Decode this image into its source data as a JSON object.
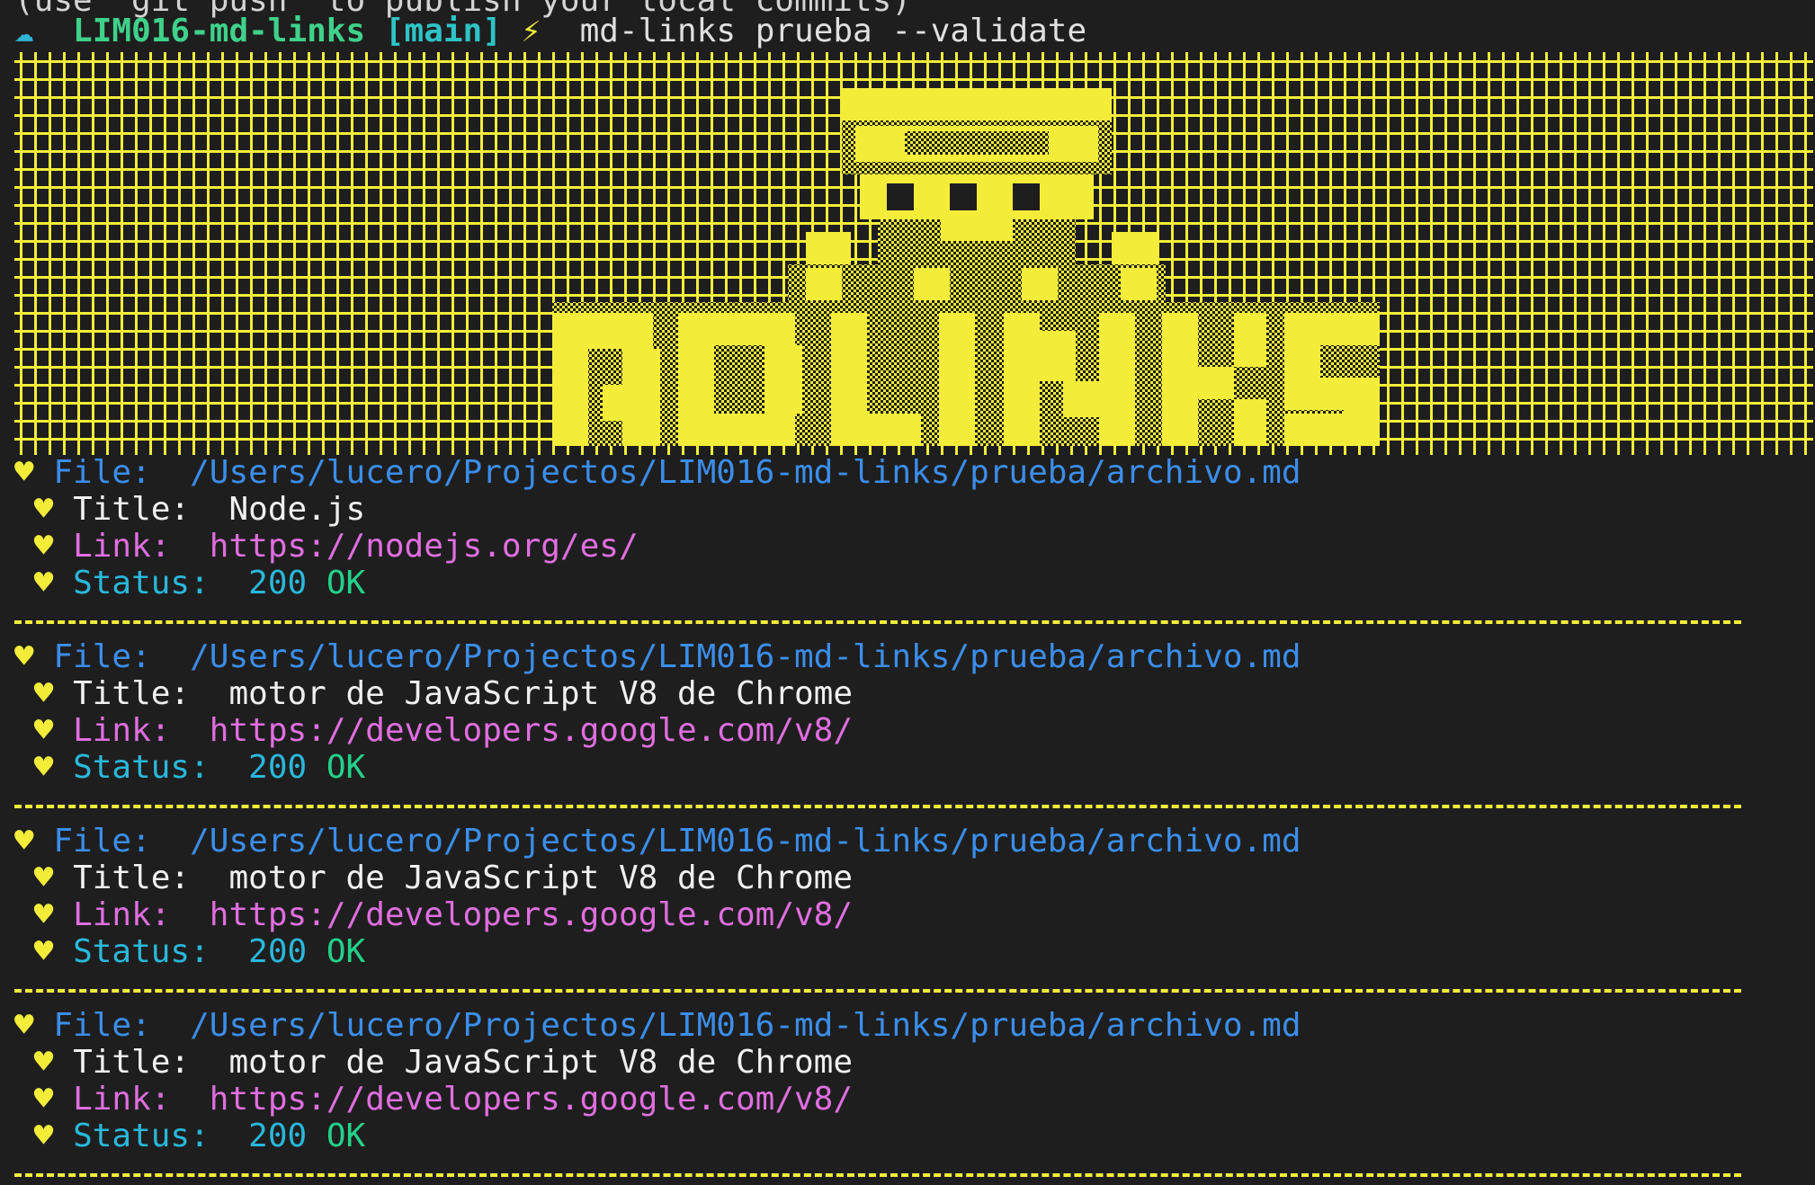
{
  "terminal": {
    "cut_line": "(use \"git push\" to publish your local commits)",
    "prompt": {
      "cloud_icon": "☁",
      "repo": "LIM016-md-links",
      "branch": "[main]",
      "bolt_icon": "⚡",
      "command": "md-links prueba --validate"
    },
    "banner": {
      "text": "MDLINKS",
      "color": "#f3ed3a",
      "background": "#1e1e1e"
    },
    "heart_glyph": "♥",
    "labels": {
      "file": "File:",
      "title": "Title:",
      "link": "Link:",
      "status": "Status:"
    },
    "results": [
      {
        "file": "/Users/lucero/Projectos/LIM016-md-links/prueba/archivo.md",
        "title": "Node.js",
        "link": "https://nodejs.org/es/",
        "status_code": "200",
        "status_text": "OK"
      },
      {
        "file": "/Users/lucero/Projectos/LIM016-md-links/prueba/archivo.md",
        "title": "motor de JavaScript V8 de Chrome",
        "link": "https://developers.google.com/v8/",
        "status_code": "200",
        "status_text": "OK"
      },
      {
        "file": "/Users/lucero/Projectos/LIM016-md-links/prueba/archivo.md",
        "title": "motor de JavaScript V8 de Chrome",
        "link": "https://developers.google.com/v8/",
        "status_code": "200",
        "status_text": "OK"
      },
      {
        "file": "/Users/lucero/Projectos/LIM016-md-links/prueba/archivo.md",
        "title": "motor de JavaScript V8 de Chrome",
        "link": "https://developers.google.com/v8/",
        "status_code": "200",
        "status_text": "OK"
      }
    ]
  }
}
